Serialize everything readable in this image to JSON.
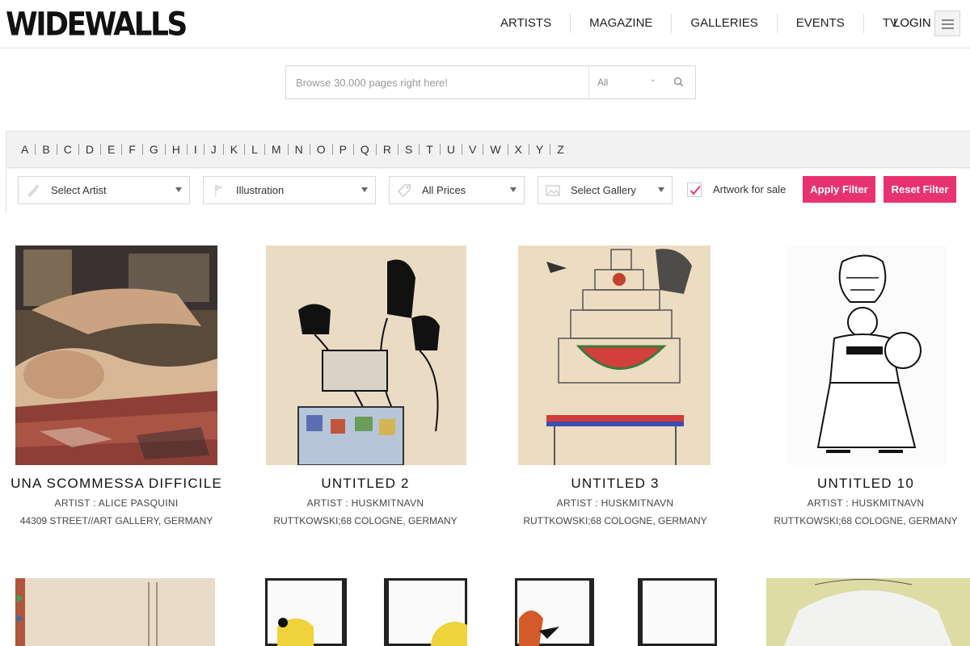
{
  "header": {
    "logo": "WIDEWALLS",
    "nav": [
      "ARTISTS",
      "MAGAZINE",
      "GALLERIES",
      "EVENTS",
      "TV"
    ],
    "login": "LOGIN"
  },
  "search": {
    "placeholder": "Browse 30.000 pages right here!",
    "scope": "All"
  },
  "alphabet": [
    "A",
    "B",
    "C",
    "D",
    "E",
    "F",
    "G",
    "H",
    "I",
    "J",
    "K",
    "L",
    "M",
    "N",
    "O",
    "P",
    "Q",
    "R",
    "S",
    "T",
    "U",
    "V",
    "W",
    "X",
    "Y",
    "Z"
  ],
  "filters": {
    "artist": "Select Artist",
    "category": "Illustration",
    "price": "All Prices",
    "gallery": "Select Gallery",
    "for_sale_label": "Artwork for sale",
    "for_sale_checked": true,
    "apply": "Apply Filter",
    "reset": "Reset Filter"
  },
  "accent_color": "#e8326f",
  "artworks": [
    {
      "title": "UNA SCOMMESSA DIFFICILE",
      "artist": "ARTIST : ALICE PASQUINI",
      "location": "44309 STREET//ART GALLERY, GERMANY"
    },
    {
      "title": "UNTITLED 2",
      "artist": "ARTIST : HUSKMITNAVN",
      "location": "RUTTKOWSKI;68 COLOGNE, GERMANY"
    },
    {
      "title": "UNTITLED 3",
      "artist": "ARTIST : HUSKMITNAVN",
      "location": "RUTTKOWSKI;68 COLOGNE, GERMANY"
    },
    {
      "title": "UNTITLED 10",
      "artist": "ARTIST : HUSKMITNAVN",
      "location": "RUTTKOWSKI;68 COLOGNE, GERMANY"
    }
  ]
}
